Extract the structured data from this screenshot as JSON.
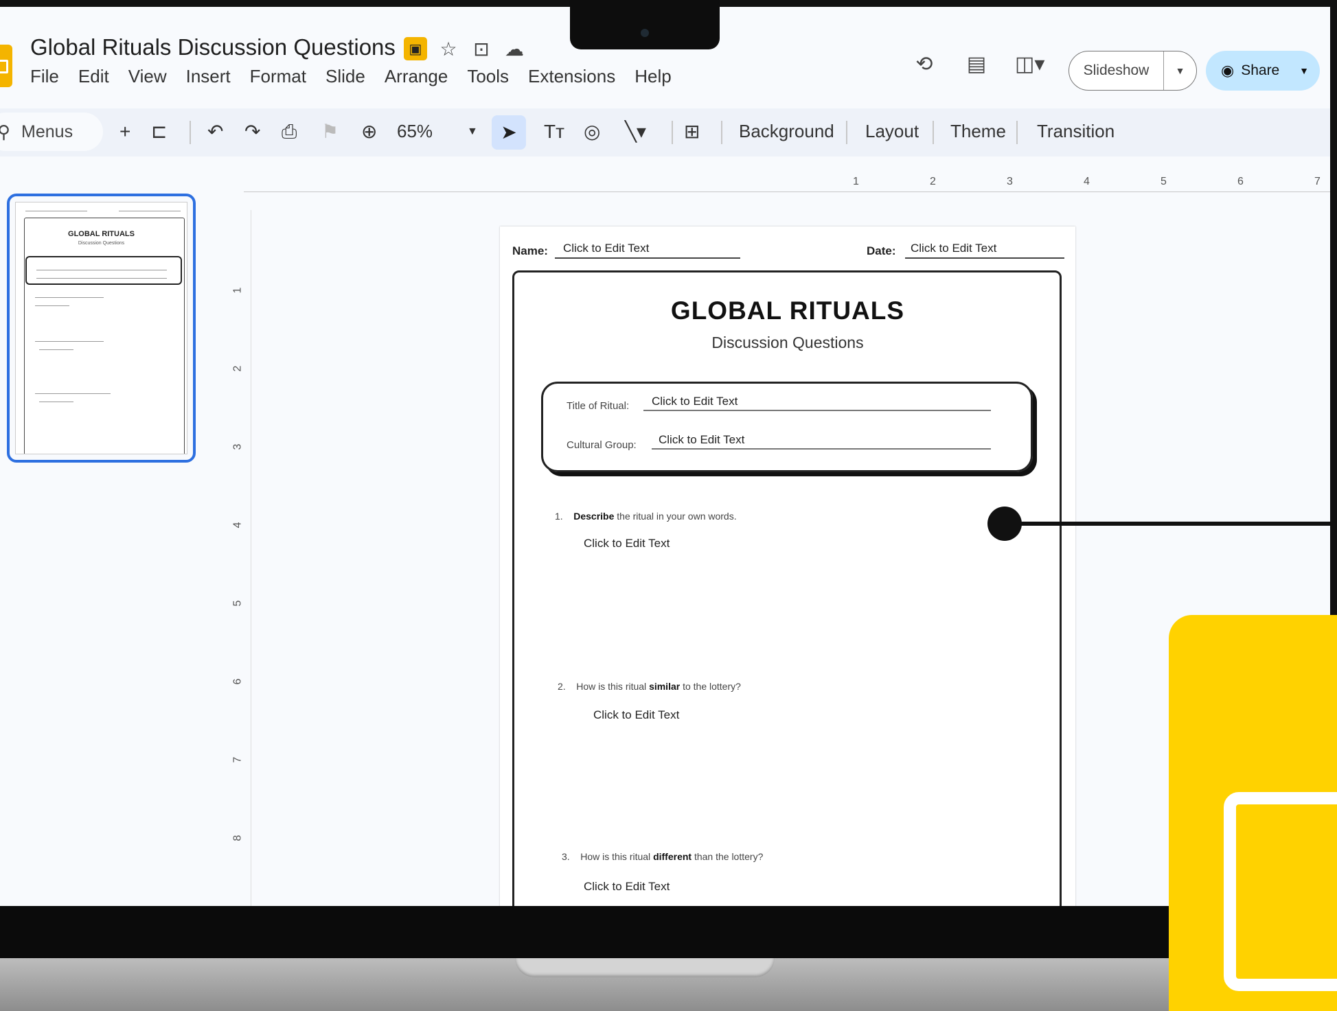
{
  "app": {
    "title": "Global Rituals Discussion Questions",
    "menu": [
      "File",
      "Edit",
      "View",
      "Insert",
      "Format",
      "Slide",
      "Arrange",
      "Tools",
      "Extensions",
      "Help"
    ],
    "slideshow_label": "Slideshow",
    "share_label": "Share"
  },
  "toolbar": {
    "search_label": "Menus",
    "zoom": "65%",
    "background_label": "Background",
    "layout_label": "Layout",
    "theme_label": "Theme",
    "transition_label": "Transition"
  },
  "ruler": {
    "top_numbers": [
      "1",
      "2",
      "3",
      "4",
      "5",
      "6",
      "7"
    ],
    "left_numbers": [
      "1",
      "2",
      "3",
      "4",
      "5",
      "6",
      "7",
      "8"
    ]
  },
  "thumbnail": {
    "title": "GLOBAL RITUALS",
    "subtitle": "Discussion Questions"
  },
  "slide": {
    "name_label": "Name:",
    "name_value": "Click to Edit Text",
    "date_label": "Date:",
    "date_value": "Click to Edit Text",
    "title": "GLOBAL RITUALS",
    "subtitle": "Discussion Questions",
    "ritual_label": "Title of Ritual:",
    "ritual_value": "Click to Edit Text",
    "group_label": "Cultural Group:",
    "group_value": "Click to Edit Text",
    "questions": [
      {
        "num": "1.",
        "bold": "Describe",
        "pre": "",
        "post": " the ritual in your own words.",
        "answer": "Click to Edit Text"
      },
      {
        "num": "2.",
        "bold": "similar",
        "pre": "How is this ritual ",
        "post": " to the lottery?",
        "answer": "Click to Edit Text"
      },
      {
        "num": "3.",
        "bold": "different",
        "pre": "How is this ritual ",
        "post": " than the lottery?",
        "answer": "Click to Edit Text"
      }
    ]
  }
}
